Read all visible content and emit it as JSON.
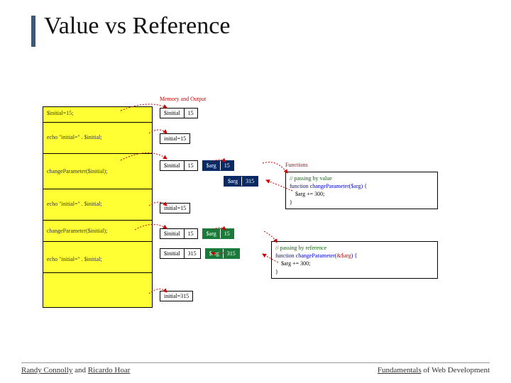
{
  "title": "Value vs Reference",
  "labels": {
    "memout": "Memory and Output",
    "functions": "Functions"
  },
  "code": [
    "$initial=15;",
    "echo \"initial=\" . $initial;",
    "changeParameter($initial);",
    "echo \"initial=\" . $initial;",
    "changeParameter($initial);",
    "echo \"initial=\" . $initial;"
  ],
  "mem": {
    "r1_var": "$initial",
    "r1_val": "15",
    "r2_out": "initial=15",
    "r3_var": "$initial",
    "r3_val": "15",
    "r3_arg": "$arg",
    "r3_argv": "15",
    "r3b_arg": "$arg",
    "r3b_argv": "315",
    "r4_out": "initial=15",
    "r5_var": "$initial",
    "r5_val": "15",
    "r5_arg": "$arg",
    "r5_argv": "15",
    "r6_var": "$initial",
    "r6_val": "315",
    "r6_arg": "$arg",
    "r6_argv": "315",
    "r7_out": "initial=315"
  },
  "func1": {
    "cmt": "// passing by value",
    "sig": "function changeParameter($arg) {",
    "body": "    $arg += 300;",
    "end": "}"
  },
  "func2": {
    "cmt": "// passing by reference",
    "sig_pre": "function changeParameter(",
    "sig_ref": "&$arg",
    "sig_post": ") {",
    "body": "    $arg += 300;",
    "end": "}"
  },
  "footer": {
    "left_u1": "Randy Connolly",
    "left_mid": " and ",
    "left_u2": "Ricardo Hoar",
    "right_u": "Fundamentals",
    "right_rest": " of Web Development"
  }
}
